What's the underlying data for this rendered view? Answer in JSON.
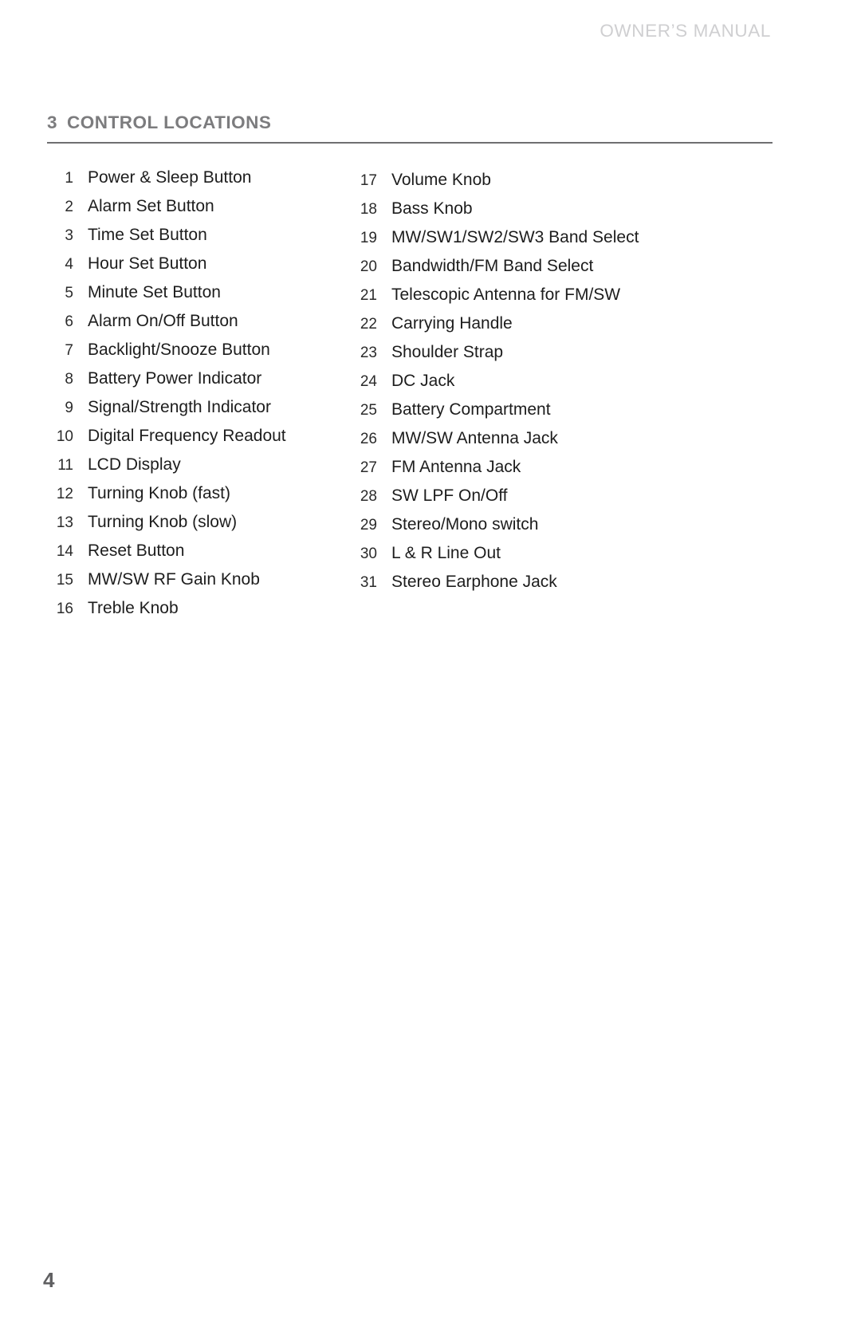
{
  "header": {
    "running_title": "OWNER’S MANUAL"
  },
  "section": {
    "number": "3",
    "title": "CONTROL LOCATIONS"
  },
  "controls": {
    "left_column": [
      {
        "num": "1",
        "label": "Power & Sleep Button"
      },
      {
        "num": "2",
        "label": "Alarm Set Button"
      },
      {
        "num": "3",
        "label": "Time Set Button"
      },
      {
        "num": "4",
        "label": "Hour Set Button"
      },
      {
        "num": "5",
        "label": "Minute Set Button"
      },
      {
        "num": "6",
        "label": "Alarm On/Off Button"
      },
      {
        "num": "7",
        "label": "Backlight/Snooze Button"
      },
      {
        "num": "8",
        "label": "Battery Power Indicator"
      },
      {
        "num": "9",
        "label": "Signal/Strength Indicator"
      },
      {
        "num": "10",
        "label": "Digital Frequency Readout"
      },
      {
        "num": "11",
        "label": "LCD Display"
      },
      {
        "num": "12",
        "label": "Turning Knob (fast)"
      },
      {
        "num": "13",
        "label": "Turning Knob (slow)"
      },
      {
        "num": "14",
        "label": "Reset Button"
      },
      {
        "num": "15",
        "label": "MW/SW RF Gain Knob"
      },
      {
        "num": "16",
        "label": "Treble Knob"
      }
    ],
    "right_column": [
      {
        "num": "17",
        "label": "Volume Knob"
      },
      {
        "num": "18",
        "label": "Bass Knob"
      },
      {
        "num": "19",
        "label": "MW/SW1/SW2/SW3 Band Select"
      },
      {
        "num": "20",
        "label": "Bandwidth/FM Band Select"
      },
      {
        "num": "21",
        "label": "Telescopic Antenna for FM/SW"
      },
      {
        "num": "22",
        "label": "Carrying Handle"
      },
      {
        "num": "23",
        "label": "Shoulder Strap"
      },
      {
        "num": "24",
        "label": "DC Jack"
      },
      {
        "num": "25",
        "label": "Battery Compartment"
      },
      {
        "num": "26",
        "label": "MW/SW Antenna Jack"
      },
      {
        "num": "27",
        "label": "FM Antenna Jack"
      },
      {
        "num": "28",
        "label": "SW LPF On/Off"
      },
      {
        "num": "29",
        "label": "Stereo/Mono switch"
      },
      {
        "num": "30",
        "label": "L & R Line Out"
      },
      {
        "num": "31",
        "label": "Stereo Earphone Jack"
      }
    ]
  },
  "footer": {
    "page_number": "4"
  },
  "colors": {
    "header_gray": "#cfcfd1",
    "title_gray": "#7c7c7e",
    "rule_gray": "#6f6f71",
    "body_text": "#1d1d1d",
    "folio_gray": "#5f5f61",
    "background": "#ffffff"
  }
}
